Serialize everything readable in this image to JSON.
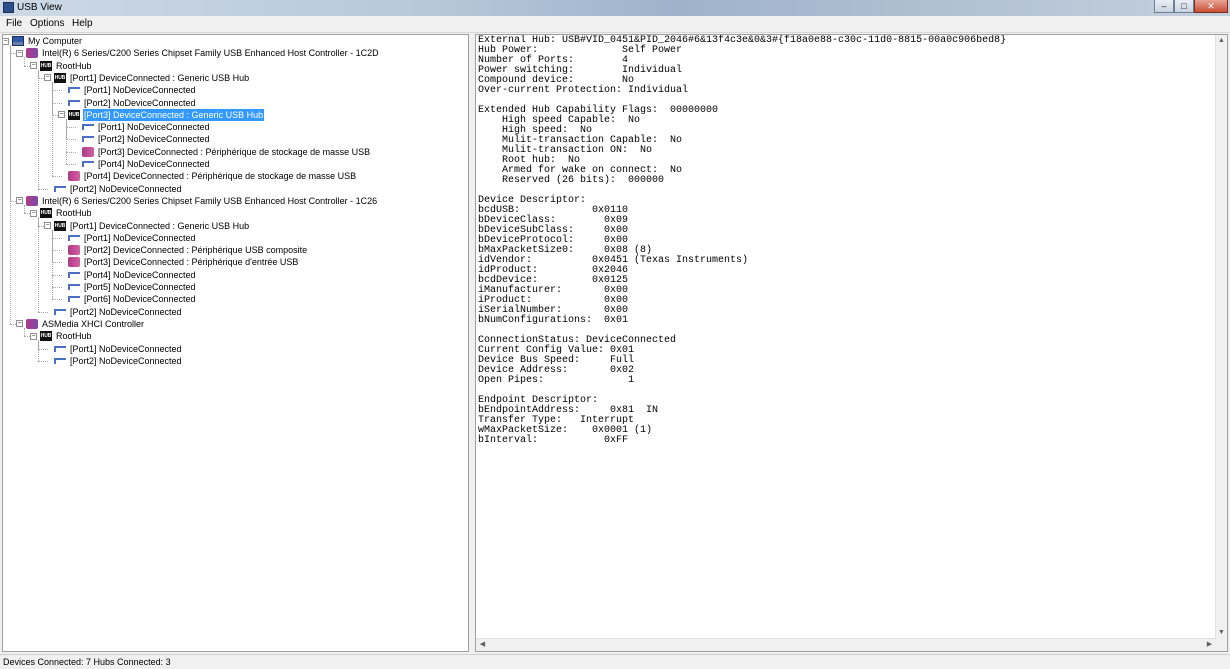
{
  "window": {
    "title": "USB View",
    "min_glyph": "–",
    "max_glyph": "□",
    "close_glyph": "✕"
  },
  "menu": [
    {
      "label": "File"
    },
    {
      "label": "Options"
    },
    {
      "label": "Help"
    }
  ],
  "tree": [
    {
      "icon": "computer",
      "label": "My Computer",
      "expander": "−"
    },
    {
      "icon": "controller",
      "label": "Intel(R) 6 Series/C200 Series Chipset Family USB Enhanced Host Controller - 1C2D",
      "expander": "−"
    },
    {
      "icon": "hub",
      "label": "RootHub",
      "expander": "−"
    },
    {
      "icon": "hub",
      "label": "[Port1] DeviceConnected :  Generic USB Hub",
      "expander": "−"
    },
    {
      "icon": "port",
      "label": "[Port1] NoDeviceConnected",
      "expander": ""
    },
    {
      "icon": "port",
      "label": "[Port2] NoDeviceConnected",
      "expander": ""
    },
    {
      "icon": "hub",
      "label": "[Port3] DeviceConnected :  Generic USB Hub",
      "expander": "−",
      "selected": true
    },
    {
      "icon": "port",
      "label": "[Port1] NoDeviceConnected",
      "expander": ""
    },
    {
      "icon": "port",
      "label": "[Port2] NoDeviceConnected",
      "expander": ""
    },
    {
      "icon": "device",
      "label": "[Port3] DeviceConnected :  Périphérique de stockage de masse USB",
      "expander": ""
    },
    {
      "icon": "port",
      "label": "[Port4] NoDeviceConnected",
      "expander": ""
    },
    {
      "icon": "device",
      "label": "[Port4] DeviceConnected :  Périphérique de stockage de masse USB",
      "expander": ""
    },
    {
      "icon": "port",
      "label": "[Port2] NoDeviceConnected",
      "expander": ""
    },
    {
      "icon": "controller",
      "label": "Intel(R) 6 Series/C200 Series Chipset Family USB Enhanced Host Controller - 1C26",
      "expander": "−"
    },
    {
      "icon": "hub",
      "label": "RootHub",
      "expander": "−"
    },
    {
      "icon": "hub",
      "label": "[Port1] DeviceConnected :  Generic USB Hub",
      "expander": "−"
    },
    {
      "icon": "port",
      "label": "[Port1] NoDeviceConnected",
      "expander": ""
    },
    {
      "icon": "device",
      "label": "[Port2] DeviceConnected :  Périphérique USB composite",
      "expander": ""
    },
    {
      "icon": "device",
      "label": "[Port3] DeviceConnected :  Périphérique d'entrée USB",
      "expander": ""
    },
    {
      "icon": "port",
      "label": "[Port4] NoDeviceConnected",
      "expander": ""
    },
    {
      "icon": "port",
      "label": "[Port5] NoDeviceConnected",
      "expander": ""
    },
    {
      "icon": "port",
      "label": "[Port6] NoDeviceConnected",
      "expander": ""
    },
    {
      "icon": "port",
      "label": "[Port2] NoDeviceConnected",
      "expander": ""
    },
    {
      "icon": "controller",
      "label": "ASMedia XHCI Controller",
      "expander": "−"
    },
    {
      "icon": "hub",
      "label": "RootHub",
      "expander": "−"
    },
    {
      "icon": "port",
      "label": "[Port1] NoDeviceConnected",
      "expander": ""
    },
    {
      "icon": "port",
      "label": "[Port2] NoDeviceConnected",
      "expander": ""
    }
  ],
  "details": [
    "External Hub: USB#VID_0451&PID_2046#6&13f4c3e&0&3#{f18a0e88-c30c-11d0-8815-00a0c906bed8}",
    "Hub Power:              Self Power",
    "Number of Ports:        4",
    "Power switching:        Individual",
    "Compound device:        No",
    "Over-current Protection: Individual",
    "",
    "Extended Hub Capability Flags:  00000000",
    "    High speed Capable:  No",
    "    High speed:  No",
    "    Mulit-transaction Capable:  No",
    "    Mulit-transaction ON:  No",
    "    Root hub:  No",
    "    Armed for wake on connect:  No",
    "    Reserved (26 bits):  000000",
    "",
    "Device Descriptor:",
    "bcdUSB:            0x0110",
    "bDeviceClass:        0x09",
    "bDeviceSubClass:     0x00",
    "bDeviceProtocol:     0x00",
    "bMaxPacketSize0:     0x08 (8)",
    "idVendor:          0x0451 (Texas Instruments)",
    "idProduct:         0x2046",
    "bcdDevice:         0x0125",
    "iManufacturer:       0x00",
    "iProduct:            0x00",
    "iSerialNumber:       0x00",
    "bNumConfigurations:  0x01",
    "",
    "ConnectionStatus: DeviceConnected",
    "Current Config Value: 0x01",
    "Device Bus Speed:     Full",
    "Device Address:       0x02",
    "Open Pipes:              1",
    "",
    "Endpoint Descriptor:",
    "bEndpointAddress:     0x81  IN",
    "Transfer Type:   Interrupt",
    "wMaxPacketSize:    0x0001 (1)",
    "bInterval:           0xFF"
  ],
  "status": "Devices Connected: 7   Hubs Connected: 3",
  "scroll": {
    "up": "▲",
    "down": "▼",
    "left": "◀",
    "right": "▶"
  }
}
